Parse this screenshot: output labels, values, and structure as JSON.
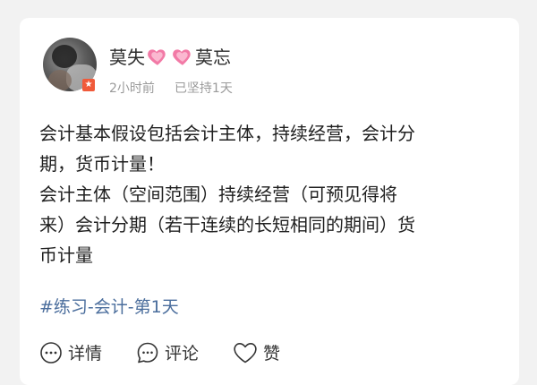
{
  "post": {
    "user_name_part1": "莫失",
    "user_name_part2": "莫忘",
    "name_emoji": "pink-heart-icon",
    "avatar_badge": "★",
    "time_ago": "2小时前",
    "streak": "已坚持1天",
    "content_lines": [
      "会计基本假设包括会计主体，持续经营，会计分",
      "期，货币计量！",
      "会计主体（空间范围）持续经营（可预见得将",
      "来）会计分期（若干连续的长短相同的期间）货",
      "币计量"
    ],
    "tag": "#练习-会计-第1天"
  },
  "actions": {
    "details_label": "详情",
    "comment_label": "评论",
    "like_label": "赞"
  },
  "colors": {
    "accent_tag": "#4a6d9c",
    "heart_pink": "#f27aa6",
    "meta_gray": "#9a9a9a"
  }
}
